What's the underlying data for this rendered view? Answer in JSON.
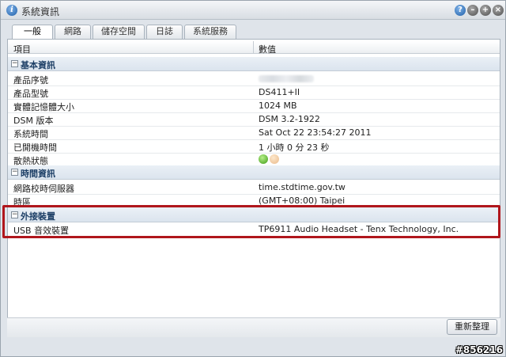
{
  "window": {
    "title": "系統資訊",
    "buttons": {
      "help": "?",
      "min": "",
      "max": "",
      "close": ""
    }
  },
  "tabs": [
    {
      "label": "一般",
      "active": true
    },
    {
      "label": "網路",
      "active": false
    },
    {
      "label": "儲存空間",
      "active": false
    },
    {
      "label": "日誌",
      "active": false
    },
    {
      "label": "系統服務",
      "active": false
    }
  ],
  "grid": {
    "col_item": "項目",
    "col_value": "數值"
  },
  "groups": {
    "basic": {
      "title": "基本資訊",
      "rows": [
        {
          "label": "產品序號",
          "value": ""
        },
        {
          "label": "產品型號",
          "value": "DS411+II"
        },
        {
          "label": "實體記憶體大小",
          "value": "1024 MB"
        },
        {
          "label": "DSM 版本",
          "value": "DSM 3.2-1922"
        },
        {
          "label": "系統時間",
          "value": "Sat Oct 22 23:54:27 2011"
        },
        {
          "label": "已開機時間",
          "value": "1 小時 0 分 23 秒"
        },
        {
          "label": "散熱狀態",
          "value": ""
        }
      ]
    },
    "time": {
      "title": "時間資訊",
      "rows": [
        {
          "label": "網路校時伺服器",
          "value": "time.stdtime.gov.tw"
        },
        {
          "label": "時區",
          "value": "(GMT+08:00) Taipei"
        }
      ]
    },
    "external": {
      "title": "外接裝置",
      "rows": [
        {
          "label": "USB 音效裝置",
          "value": "TP6911 Audio Headset - Tenx Technology, Inc."
        }
      ]
    }
  },
  "footer": {
    "refresh_label": "重新整理"
  },
  "watermark": "#856216",
  "colors": {
    "highlight": "#b0161c",
    "group_title": "#1d3f66"
  }
}
